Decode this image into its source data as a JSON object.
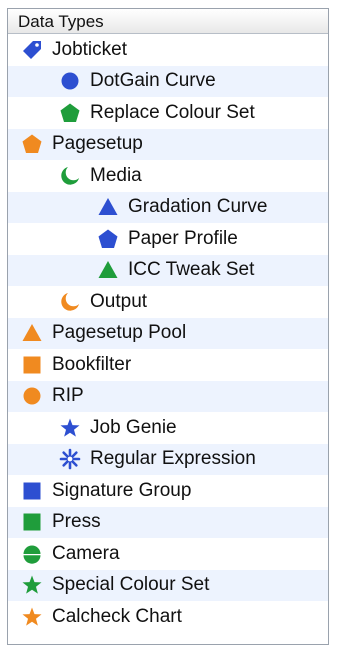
{
  "panel": {
    "header": "Data Types"
  },
  "colors": {
    "blue": "#2d4fd1",
    "green": "#1f9d3b",
    "orange": "#f08a20",
    "alt_row": "#edf3fe"
  },
  "items": [
    {
      "label": "Jobticket",
      "icon": "blue-tag-icon",
      "level": 0
    },
    {
      "label": "DotGain Curve",
      "icon": "blue-circle-icon",
      "level": 1
    },
    {
      "label": "Replace Colour Set",
      "icon": "green-pentagon-icon",
      "level": 1
    },
    {
      "label": "Pagesetup",
      "icon": "orange-pentagon-icon",
      "level": 0
    },
    {
      "label": "Media",
      "icon": "green-crescent-icon",
      "level": 1
    },
    {
      "label": "Gradation Curve",
      "icon": "blue-triangle-icon",
      "level": 2
    },
    {
      "label": "Paper Profile",
      "icon": "blue-pentagon-icon",
      "level": 2
    },
    {
      "label": "ICC Tweak Set",
      "icon": "green-triangle-icon",
      "level": 2
    },
    {
      "label": "Output",
      "icon": "orange-crescent-icon",
      "level": 1
    },
    {
      "label": "Pagesetup Pool",
      "icon": "orange-triangle-icon",
      "level": 0
    },
    {
      "label": "Bookfilter",
      "icon": "orange-square-icon",
      "level": 0
    },
    {
      "label": "RIP",
      "icon": "orange-circle-icon",
      "level": 0
    },
    {
      "label": "Job Genie",
      "icon": "blue-star-icon",
      "level": 1
    },
    {
      "label": "Regular Expression",
      "icon": "blue-asterisk-icon",
      "level": 1
    },
    {
      "label": "Signature Group",
      "icon": "blue-square-icon",
      "level": 0
    },
    {
      "label": "Press",
      "icon": "green-square-icon",
      "level": 0
    },
    {
      "label": "Camera",
      "icon": "green-half-circle-icon",
      "level": 0
    },
    {
      "label": "Special Colour Set",
      "icon": "green-star-icon",
      "level": 0
    },
    {
      "label": "Calcheck Chart",
      "icon": "orange-star-icon",
      "level": 0
    }
  ]
}
